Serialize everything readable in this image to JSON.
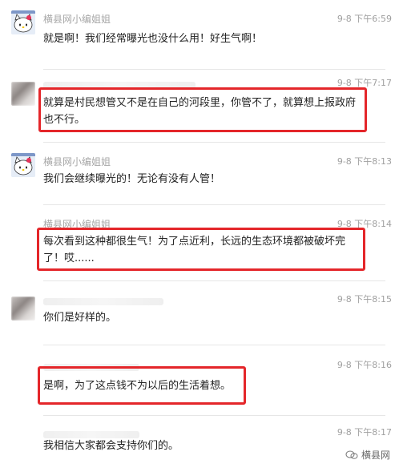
{
  "comments": [
    {
      "name": "横县网小编姐姐",
      "time": "9-8 下午6:59",
      "text": "就是啊！我们经常曝光也没什么用！好生气啊！",
      "avatar": "hello-kitty-avatar",
      "name_visible": true
    },
    {
      "name": "",
      "time": "9-8 下午7:17",
      "text": "就算是村民想管又不是在自己的河段里，你管不了，就算想上报政府也不行。",
      "avatar": "blurred-avatar",
      "name_visible": false
    },
    {
      "name": "横县网小编姐姐",
      "time": "9-8 下午8:13",
      "text": "我们会继续曝光的！无论有没有人管！",
      "avatar": "hello-kitty-avatar",
      "name_visible": true
    },
    {
      "name": "横县网小编姐姐",
      "time": "9-8 下午8:14",
      "text": "每次看到这种都很生气！为了点近利，长远的生态环境都被破坏完了！哎......",
      "avatar": "none",
      "name_visible": true
    },
    {
      "name": "",
      "time": "9-8 下午8:15",
      "text": "你们是好样的。",
      "avatar": "blurred-avatar",
      "name_visible": false
    },
    {
      "name": "",
      "time": "9-8 下午8:16",
      "text": "是啊，为了这点钱不为以后的生活着想。",
      "avatar": "none",
      "name_visible": false
    },
    {
      "name": "",
      "time": "9-8 下午8:17",
      "text": "我相信大家都会支持你们的。",
      "avatar": "none",
      "name_visible": false
    }
  ],
  "watermark": {
    "text": "横县网",
    "icon": "wechat-official-account-icon"
  },
  "colors": {
    "highlight_border": "#e4262a",
    "name": "#a7a7a7",
    "time": "#a0a0a0",
    "text": "#222222"
  }
}
